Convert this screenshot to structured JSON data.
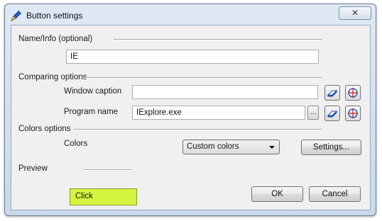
{
  "window": {
    "title": "Button settings",
    "close_glyph": "✕"
  },
  "name_info": {
    "section_label": "Name/Info (optional)",
    "value": "IE"
  },
  "comparing": {
    "section_label": "Comparing options",
    "window_caption_label": "Window caption",
    "window_caption_value": "",
    "program_name_label": "Program name",
    "program_name_value": "IExplore.exe",
    "browse_label": "..."
  },
  "colors": {
    "section_label": "Colors options",
    "colors_label": "Colors",
    "selected": "Custom colors",
    "settings_label": "Settings..."
  },
  "preview": {
    "section_label": "Preview",
    "button_text": "Click",
    "button_color": "#d4f540"
  },
  "footer": {
    "ok_label": "OK",
    "cancel_label": "Cancel"
  },
  "icons": {
    "app": "pen-icon",
    "eraser": "eraser-icon",
    "crosshair": "crosshair-icon"
  }
}
